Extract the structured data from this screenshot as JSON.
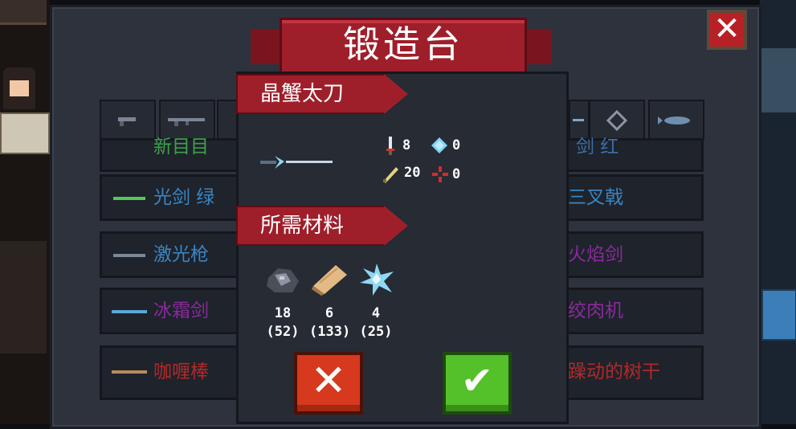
{
  "forge": {
    "title": "锻造台",
    "close_symbol": "✕"
  },
  "weapon_list": [
    {
      "label": "新目目",
      "right_label": "剑 红",
      "color": "#3fa04a",
      "right_color": "#3b6ea8"
    },
    {
      "label": "光剑 绿",
      "right_label": "三叉戟",
      "color": "#3a86c4",
      "right_color": "#3a86c4"
    },
    {
      "label": "激光枪",
      "right_label": "火焰剑",
      "color": "#3a86c4",
      "right_color": "#8a2a9e"
    },
    {
      "label": "冰霜剑",
      "right_label": "绞肉机",
      "color": "#8a2a9e",
      "right_color": "#8a2a9e"
    },
    {
      "label": "咖喱棒",
      "right_label": "躁动的树干",
      "color": "#b02a2a",
      "right_color": "#b02a2a"
    }
  ],
  "dialog": {
    "weapon_name": "晶蟹太刀",
    "stats": {
      "damage": "8",
      "energy": "0",
      "crit": "20",
      "precision": "0"
    },
    "materials_title": "所需材料",
    "materials": [
      {
        "icon": "ore-icon",
        "need": "18",
        "have": "(52)"
      },
      {
        "icon": "wood-icon",
        "need": "6",
        "have": "(133)"
      },
      {
        "icon": "crystal-icon",
        "need": "4",
        "have": "(25)"
      }
    ],
    "cancel_symbol": "✕",
    "confirm_symbol": "✔"
  },
  "colors": {
    "panel": "#2d323d",
    "ribbon": "#9e1f2a",
    "cancel": "#d7391e",
    "confirm": "#55c12a"
  }
}
